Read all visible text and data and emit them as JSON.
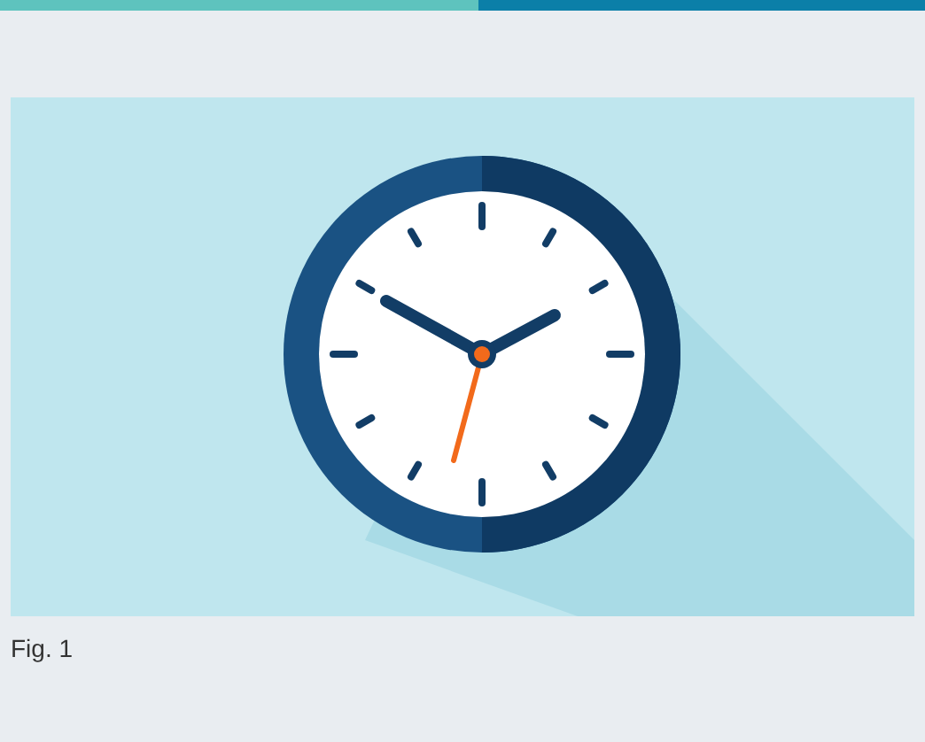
{
  "figure": {
    "caption": "Fig. 1"
  }
}
